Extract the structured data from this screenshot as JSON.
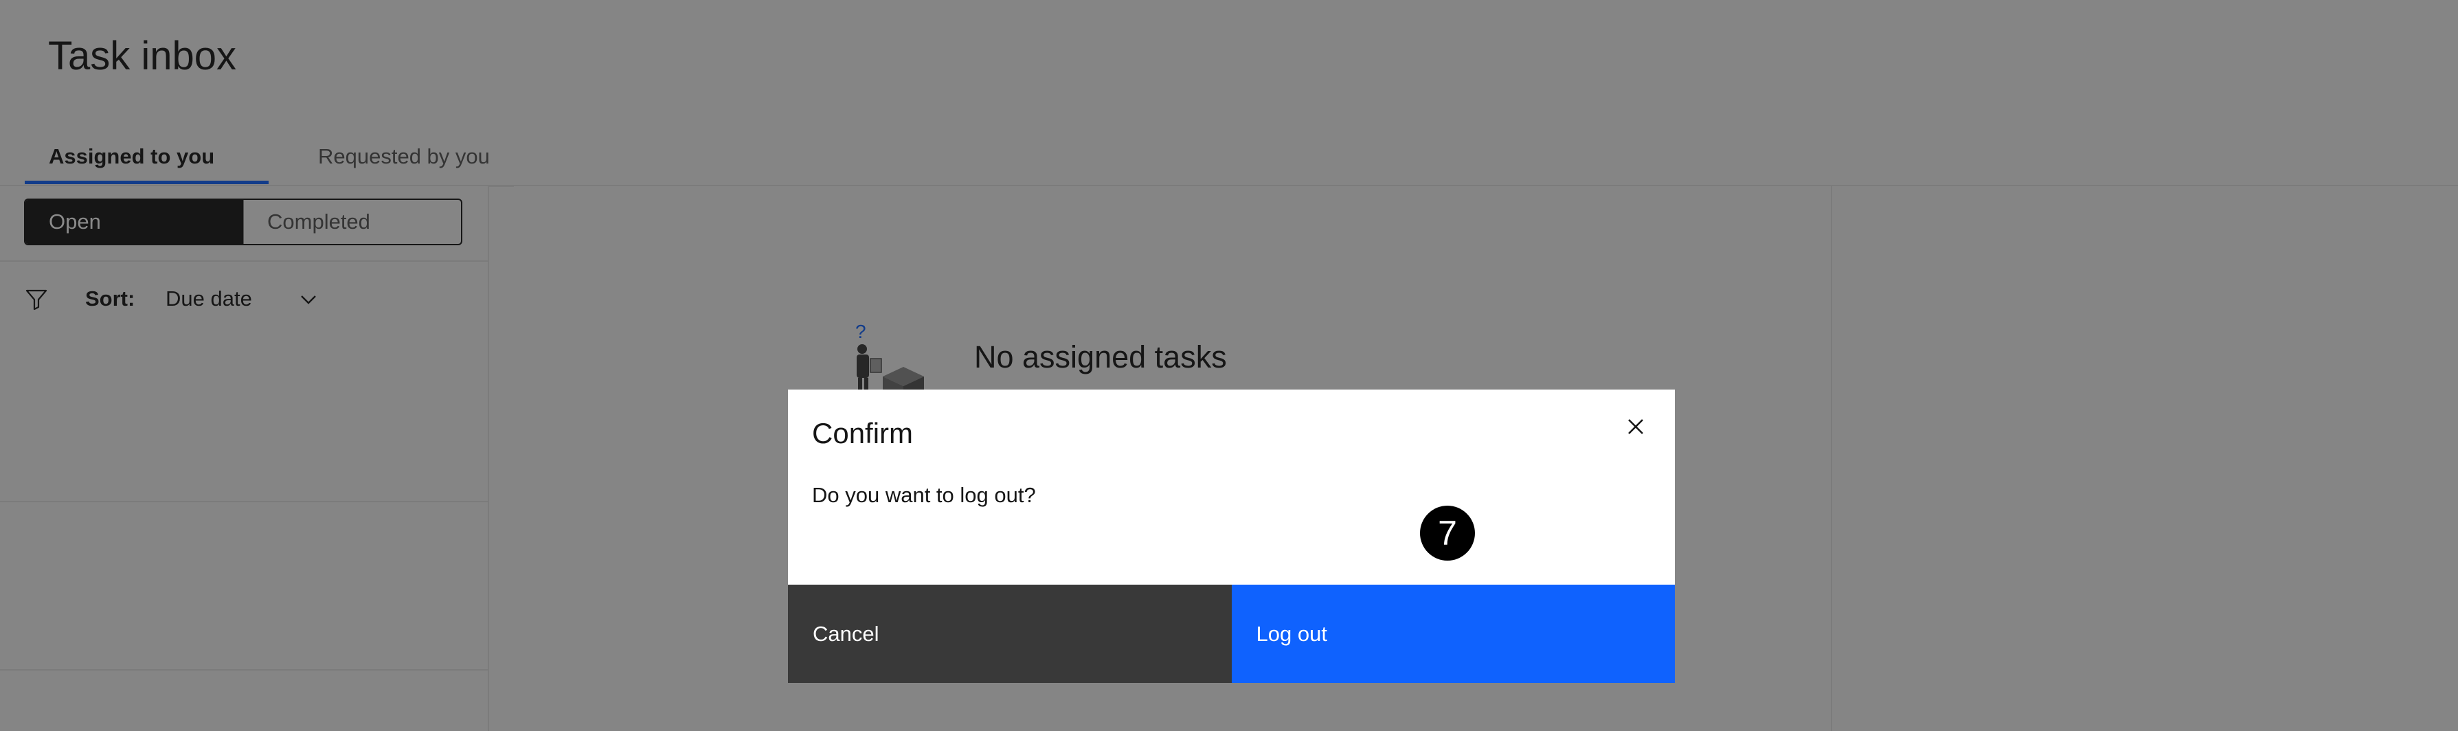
{
  "page": {
    "title": "Task inbox"
  },
  "tabs": [
    {
      "label": "Assigned to you",
      "active": true
    },
    {
      "label": "Requested by you",
      "active": false
    }
  ],
  "status_switcher": {
    "options": [
      "Open",
      "Completed"
    ],
    "selected": "Open"
  },
  "sort": {
    "filter_icon": "filter-icon",
    "label": "Sort:",
    "value": "Due date",
    "chevron_icon": "chevron-down-icon"
  },
  "empty_state": {
    "illustration": "person-with-question-and-boxes",
    "title": "No assigned tasks"
  },
  "modal": {
    "title": "Confirm",
    "body": "Do you want to log out?",
    "close_icon": "close-icon",
    "cancel_label": "Cancel",
    "confirm_label": "Log out",
    "step_badge": "7"
  },
  "colors": {
    "accent": "#0f62fe",
    "dark": "#161616",
    "secondary_button": "#393939",
    "overlay": "rgba(22,22,22,0.5)"
  }
}
